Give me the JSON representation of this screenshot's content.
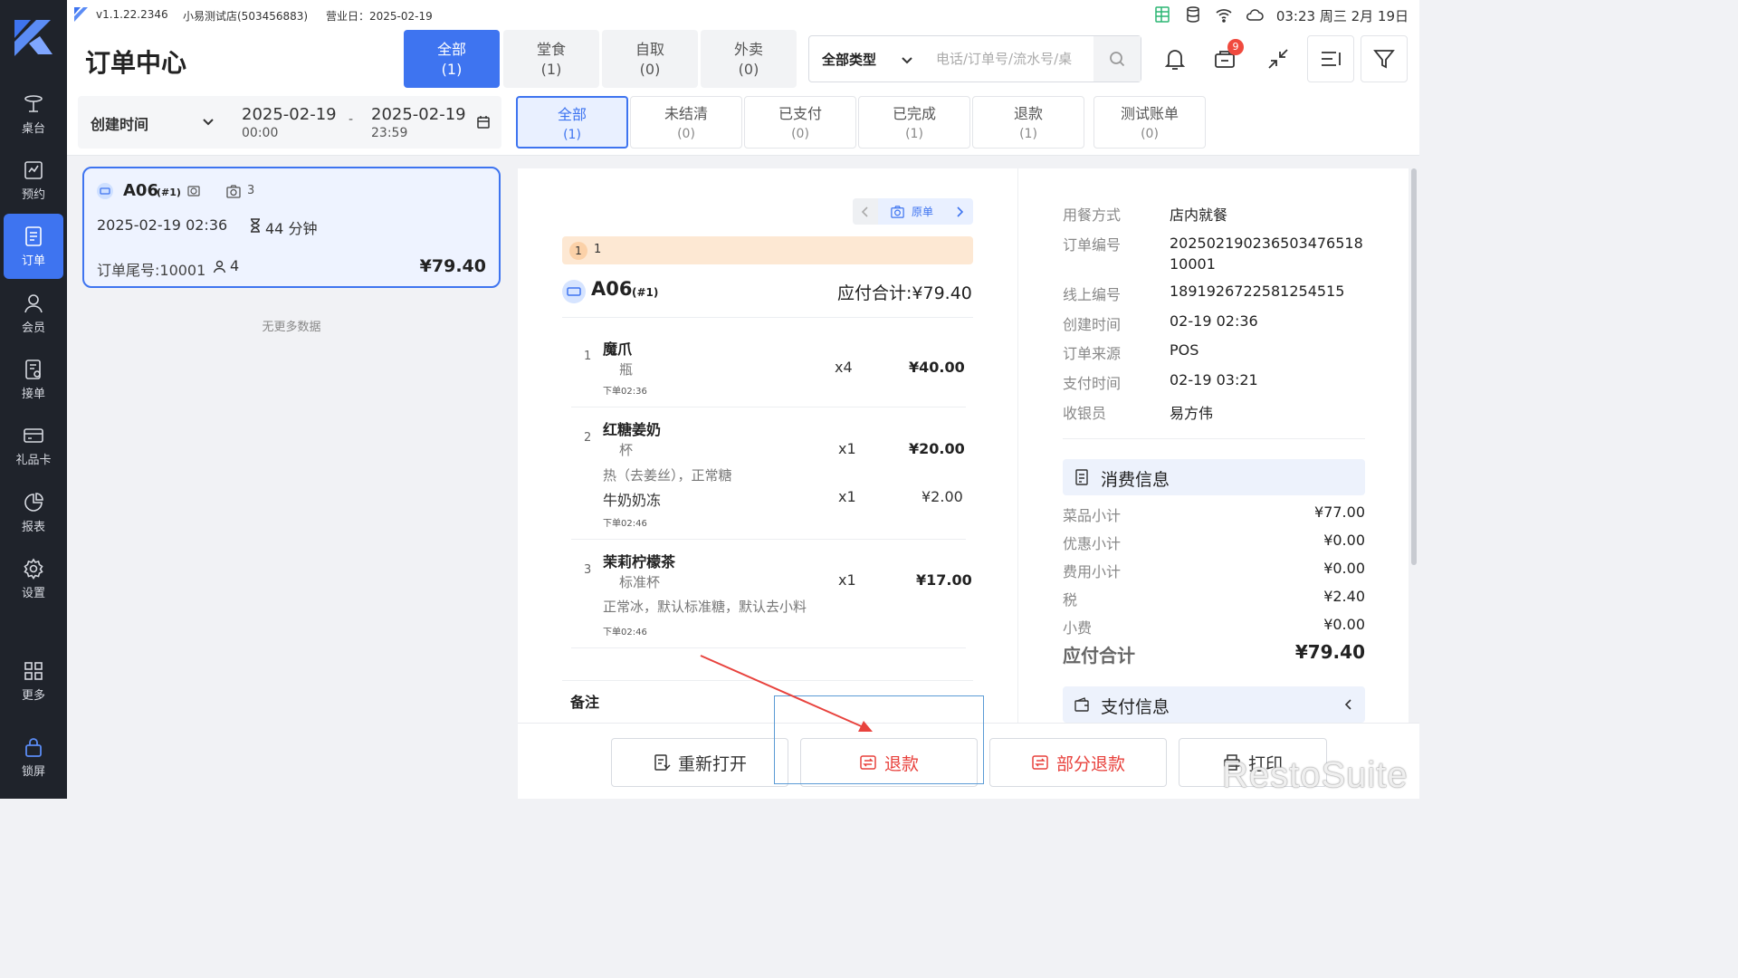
{
  "status": {
    "version": "v1.1.22.2346",
    "store": "小易测试店(503456883)",
    "business_day": "营业日：2025-02-19",
    "clock": "03:23 周三 2月 19日"
  },
  "sidebar": [
    {
      "label": "桌台",
      "icon": "table-icon"
    },
    {
      "label": "预约",
      "icon": "calendar-check-icon"
    },
    {
      "label": "订单",
      "icon": "order-icon",
      "active": true
    },
    {
      "label": "会员",
      "icon": "user-icon"
    },
    {
      "label": "接单",
      "icon": "receive-order-icon"
    },
    {
      "label": "礼品卡",
      "icon": "gift-card-icon"
    },
    {
      "label": "报表",
      "icon": "report-icon"
    },
    {
      "label": "设置",
      "icon": "gear-icon"
    },
    {
      "label": "更多",
      "icon": "grid-icon"
    },
    {
      "label": "锁屏",
      "icon": "lock-icon"
    }
  ],
  "header": {
    "title": "订单中心",
    "type_tabs": [
      {
        "label": "全部",
        "count": "(1)",
        "active": true
      },
      {
        "label": "堂食",
        "count": "(1)"
      },
      {
        "label": "自取",
        "count": "(0)"
      },
      {
        "label": "外卖",
        "count": "(0)"
      }
    ],
    "search_type": "全部类型",
    "search_placeholder": "电话/订单号/流水号/桌",
    "notification_badge": "9"
  },
  "filter": {
    "date_label": "创建时间",
    "start_date": "2025-02-19",
    "start_time": "00:00",
    "separator": "-",
    "end_date": "2025-02-19",
    "end_time": "23:59",
    "status_tabs": [
      {
        "label": "全部",
        "count": "(1)",
        "active": true
      },
      {
        "label": "未结清",
        "count": "(0)"
      },
      {
        "label": "已支付",
        "count": "(0)"
      },
      {
        "label": "已完成",
        "count": "(1)"
      },
      {
        "label": "退款",
        "count": "(1)"
      },
      {
        "label": "测试账单",
        "count": "(0)"
      }
    ]
  },
  "order_card": {
    "table": "A06",
    "seq": "(#1)",
    "guests_icon_count": "3",
    "datetime": "2025-02-19 02:36",
    "duration": "44 分钟",
    "tail_number": "订单尾号:10001",
    "people": "4",
    "amount": "¥79.40"
  },
  "no_more": "无更多数据",
  "detail": {
    "original_label": "原单",
    "round_badge": "1",
    "round_text": "1",
    "table": "A06",
    "seq": "(#1)",
    "total_label": "应付合计:¥79.40",
    "items": [
      {
        "no": "1",
        "name": "魔爪",
        "unit": "瓶",
        "qty": "x4",
        "price": "¥40.00",
        "time": "下单02:36"
      },
      {
        "no": "2",
        "name": "红糖姜奶",
        "unit": "杯",
        "qty": "x1",
        "price": "¥20.00",
        "modifiers": "热（去姜丝），正常糖",
        "addon": "牛奶奶冻",
        "addon_qty": "x1",
        "addon_price": "¥2.00",
        "time": "下单02:46"
      },
      {
        "no": "3",
        "name": "茉莉柠檬茶",
        "unit": "标准杯",
        "qty": "x1",
        "price": "¥17.00",
        "modifiers": "正常冰，默认标准糖，默认去小料",
        "time": "下单02:46"
      }
    ],
    "remark_label": "备注"
  },
  "info": [
    {
      "label": "用餐方式",
      "value": "店内就餐"
    },
    {
      "label": "订单编号",
      "value": "20250219023650347651810001"
    },
    {
      "label": "线上编号",
      "value": "1891926722581254515"
    },
    {
      "label": "创建时间",
      "value": "02-19 02:36"
    },
    {
      "label": "订单来源",
      "value": "POS"
    },
    {
      "label": "支付时间",
      "value": "02-19 03:21"
    },
    {
      "label": "收银员",
      "value": "易方伟"
    }
  ],
  "consumption": {
    "title": "消费信息",
    "rows": [
      {
        "label": "菜品小计",
        "value": "¥77.00"
      },
      {
        "label": "优惠小计",
        "value": "¥0.00"
      },
      {
        "label": "费用小计",
        "value": "¥0.00"
      },
      {
        "label": "税",
        "value": "¥2.40"
      },
      {
        "label": "小费",
        "value": "¥0.00"
      }
    ],
    "total_label": "应付合计",
    "total_value": "¥79.40"
  },
  "payment": {
    "title": "支付信息"
  },
  "actions": {
    "reopen": "重新打开",
    "refund": "退款",
    "partial_refund": "部分退款",
    "print": "打印"
  },
  "watermark": "RestoSuite",
  "colors": {
    "accent": "#3e74f0",
    "danger": "#e8423d",
    "annotation": "#e8423d"
  }
}
